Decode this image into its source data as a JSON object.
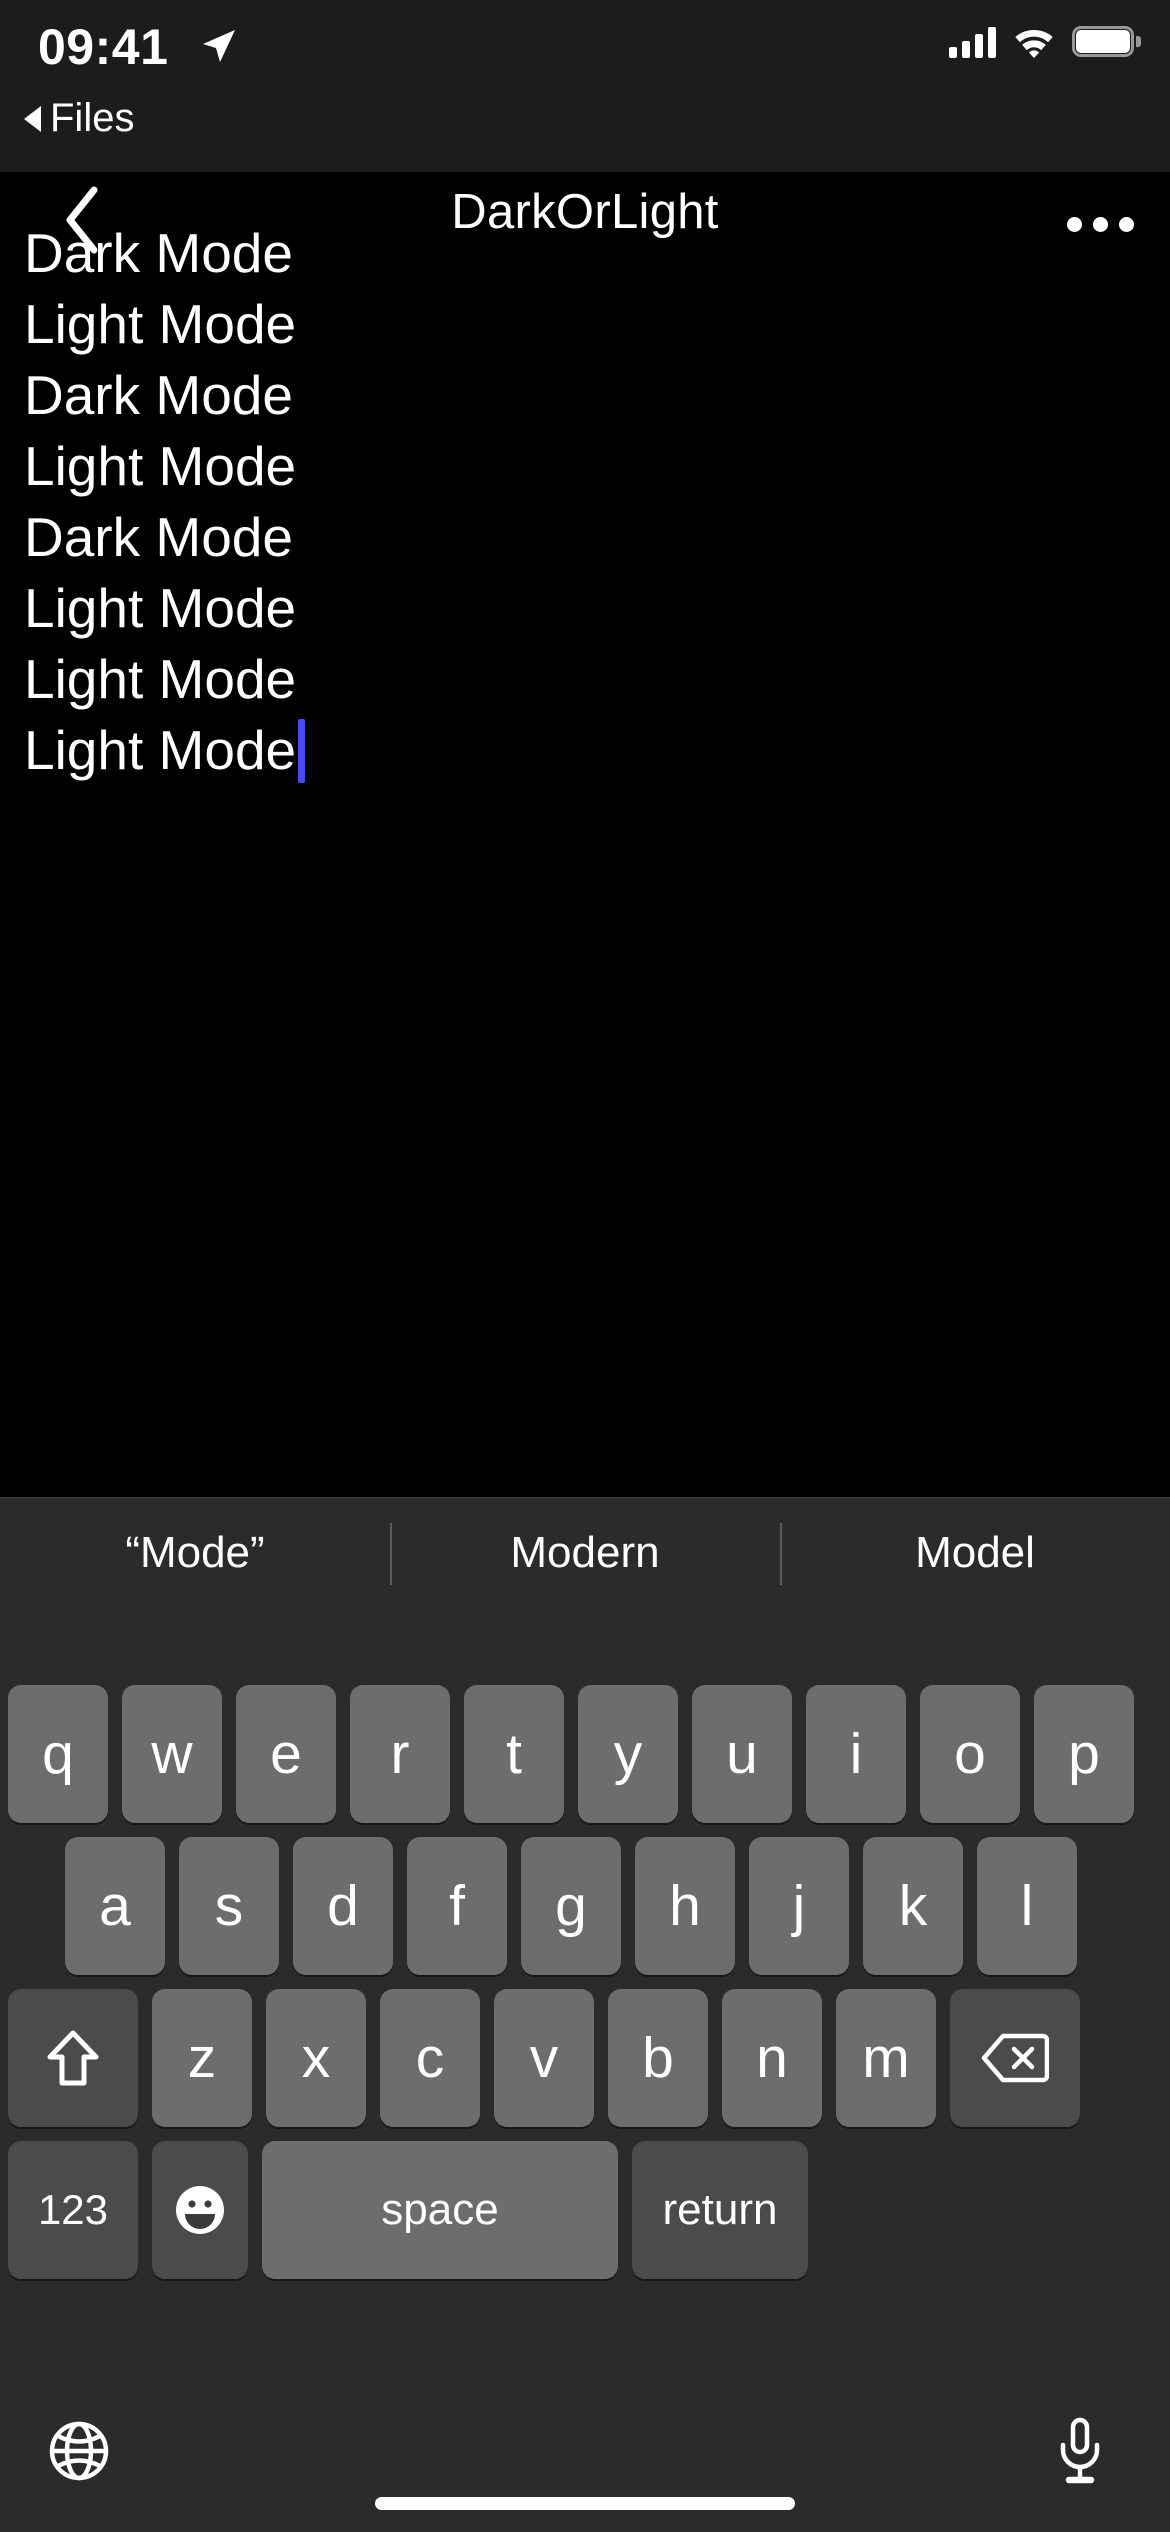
{
  "status_bar": {
    "time": "09:41",
    "location_icon": "location-arrow-icon",
    "back_app_label": "Files",
    "signal_icon": "cellular-signal-icon",
    "wifi_icon": "wifi-icon",
    "battery_icon": "battery-full-icon"
  },
  "nav_bar": {
    "back_icon": "chevron-left-icon",
    "title": "DarkOrLight",
    "more_icon": "ellipsis-icon"
  },
  "editor": {
    "background_color": "#000000",
    "text_color": "#ffffff",
    "caret_color": "#4b4bf5",
    "lines": [
      "Dark Mode",
      "Light Mode",
      "Dark Mode",
      "Light Mode",
      "Dark Mode",
      "Light Mode",
      "Light Mode",
      "Light Mode"
    ],
    "caret_line_index": 7
  },
  "keyboard": {
    "background_color": "#2b2b2b",
    "key_color": "#6d6d6d",
    "special_key_color": "#4b4b4b",
    "predictions": [
      "“Mode”",
      "Modern",
      "Model"
    ],
    "row1": [
      "q",
      "w",
      "e",
      "r",
      "t",
      "y",
      "u",
      "i",
      "o",
      "p"
    ],
    "row2": [
      "a",
      "s",
      "d",
      "f",
      "g",
      "h",
      "j",
      "k",
      "l"
    ],
    "row3_letters": [
      "z",
      "x",
      "c",
      "v",
      "b",
      "n",
      "m"
    ],
    "shift_icon": "shift-arrow-icon",
    "delete_icon": "backspace-icon",
    "numbers_label": "123",
    "emoji_icon": "smiley-face-icon",
    "space_label": "space",
    "return_label": "return",
    "globe_icon": "globe-icon",
    "dictation_icon": "microphone-icon"
  }
}
